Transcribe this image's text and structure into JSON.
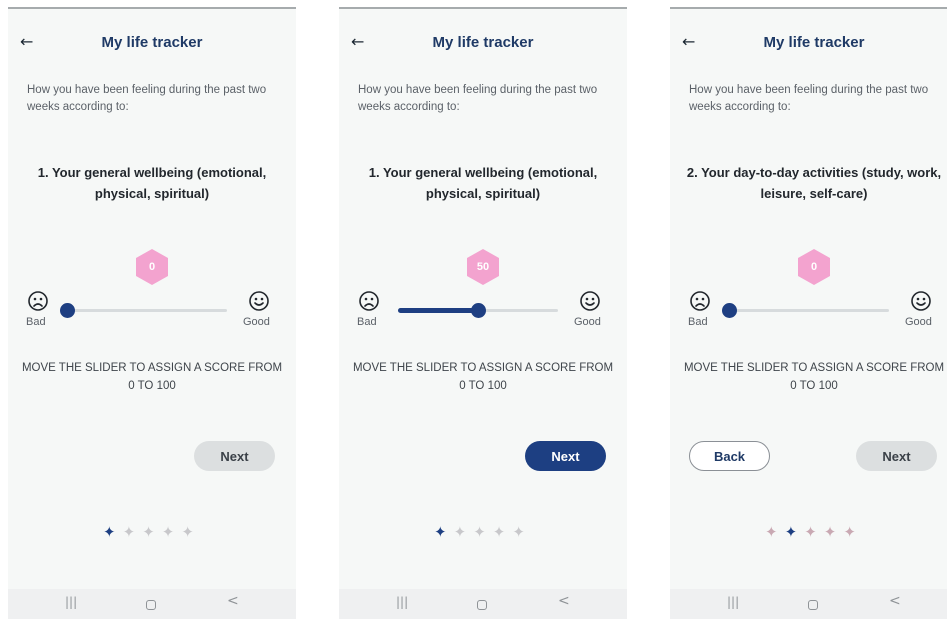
{
  "screens": [
    {
      "title": "My life tracker",
      "intro": "How you have been feeling during the past two weeks according to:",
      "question": "1. Your general wellbeing (emotional, physical, spiritual)",
      "score": "0",
      "score_value": 0,
      "bad_label": "Bad",
      "good_label": "Good",
      "instruction": "MOVE THE SLIDER TO ASSIGN A SCORE FROM 0 TO 100",
      "next_label": "Next",
      "next_state": "disabled",
      "active_step": 1,
      "total_steps": 5
    },
    {
      "title": "My life tracker",
      "intro": "How you have been feeling during the past two weeks according to:",
      "question": "1. Your general wellbeing (emotional, physical, spiritual)",
      "score": "50",
      "score_value": 50,
      "bad_label": "Bad",
      "good_label": "Good",
      "instruction": "MOVE THE SLIDER TO ASSIGN A SCORE FROM 0 TO 100",
      "next_label": "Next",
      "next_state": "active",
      "active_step": 1,
      "total_steps": 5
    },
    {
      "title": "My life tracker",
      "intro": "How you have been feeling during the past two weeks according to:",
      "question": "2. Your day-to-day activities (study, work, leisure, self-care)",
      "score": "0",
      "score_value": 0,
      "bad_label": "Bad",
      "good_label": "Good",
      "instruction": "MOVE THE SLIDER TO ASSIGN A SCORE FROM 0 TO 100",
      "back_label": "Back",
      "next_label": "Next",
      "next_state": "disabled",
      "active_step": 2,
      "total_steps": 5
    }
  ],
  "icons": {
    "back_arrow": "←",
    "step_star": "✦",
    "nav_recent": "|||",
    "nav_back": "<"
  },
  "colors": {
    "primary": "#1d3f82",
    "badge": "#f3a3cf",
    "disabled_button": "#dcdfe0",
    "screen_background": "#f6f8f7"
  }
}
